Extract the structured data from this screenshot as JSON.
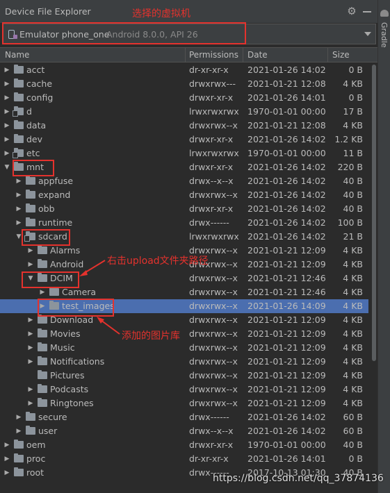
{
  "window": {
    "title": "Device File Explorer",
    "side_tab": "Gradle"
  },
  "device": {
    "name": "Emulator phone_one",
    "detail": "Android 8.0.0, API 26"
  },
  "columns": {
    "name": "Name",
    "permissions": "Permissions",
    "date": "Date",
    "size": "Size"
  },
  "rows": [
    {
      "name": "acct",
      "level": 0,
      "arrow": "right",
      "link": false,
      "perm": "dr-xr-xr-x",
      "date": "2021-01-26 14:02",
      "size": "0 B"
    },
    {
      "name": "cache",
      "level": 0,
      "arrow": "right",
      "link": false,
      "perm": "drwxrwx---",
      "date": "2021-01-21 12:08",
      "size": "4 KB"
    },
    {
      "name": "config",
      "level": 0,
      "arrow": "right",
      "link": false,
      "perm": "drwxr-xr-x",
      "date": "2021-01-26 14:01",
      "size": "0 B"
    },
    {
      "name": "d",
      "level": 0,
      "arrow": "right",
      "link": true,
      "perm": "lrwxrwxrwx",
      "date": "1970-01-01 00:00",
      "size": "17 B"
    },
    {
      "name": "data",
      "level": 0,
      "arrow": "right",
      "link": false,
      "perm": "drwxrwx--x",
      "date": "2021-01-21 12:08",
      "size": "4 KB"
    },
    {
      "name": "dev",
      "level": 0,
      "arrow": "right",
      "link": false,
      "perm": "drwxr-xr-x",
      "date": "2021-01-26 14:02",
      "size": "1.2 KB"
    },
    {
      "name": "etc",
      "level": 0,
      "arrow": "right",
      "link": true,
      "perm": "lrwxrwxrwx",
      "date": "1970-01-01 00:00",
      "size": "11 B"
    },
    {
      "name": "mnt",
      "level": 0,
      "arrow": "down",
      "link": false,
      "perm": "drwxr-xr-x",
      "date": "2021-01-26 14:02",
      "size": "220 B"
    },
    {
      "name": "appfuse",
      "level": 1,
      "arrow": "right",
      "link": false,
      "perm": "drwx--x--x",
      "date": "2021-01-26 14:02",
      "size": "40 B"
    },
    {
      "name": "expand",
      "level": 1,
      "arrow": "right",
      "link": false,
      "perm": "drwxrwx--x",
      "date": "2021-01-26 14:02",
      "size": "40 B"
    },
    {
      "name": "obb",
      "level": 1,
      "arrow": "right",
      "link": false,
      "perm": "drwxr-xr-x",
      "date": "2021-01-26 14:02",
      "size": "40 B"
    },
    {
      "name": "runtime",
      "level": 1,
      "arrow": "right",
      "link": false,
      "perm": "drwx------",
      "date": "2021-01-26 14:02",
      "size": "100 B"
    },
    {
      "name": "sdcard",
      "level": 1,
      "arrow": "down",
      "link": true,
      "perm": "lrwxrwxrwx",
      "date": "2021-01-26 14:02",
      "size": "21 B"
    },
    {
      "name": "Alarms",
      "level": 2,
      "arrow": "right",
      "link": false,
      "perm": "drwxrwx--x",
      "date": "2021-01-21 12:09",
      "size": "4 KB"
    },
    {
      "name": "Android",
      "level": 2,
      "arrow": "right",
      "link": false,
      "perm": "drwxrwx--x",
      "date": "2021-01-21 12:09",
      "size": "4 KB"
    },
    {
      "name": "DCIM",
      "level": 2,
      "arrow": "down",
      "link": false,
      "perm": "drwxrwx--x",
      "date": "2021-01-21 12:46",
      "size": "4 KB"
    },
    {
      "name": "Camera",
      "level": 3,
      "arrow": "right",
      "link": false,
      "perm": "drwxrwx--x",
      "date": "2021-01-21 12:46",
      "size": "4 KB"
    },
    {
      "name": "test_images",
      "level": 3,
      "arrow": "right",
      "link": false,
      "perm": "drwxrwx--x",
      "date": "2021-01-26 14:09",
      "size": "4 KB",
      "selected": true
    },
    {
      "name": "Download",
      "level": 2,
      "arrow": "right",
      "link": false,
      "perm": "drwxrwx--x",
      "date": "2021-01-21 12:09",
      "size": "4 KB"
    },
    {
      "name": "Movies",
      "level": 2,
      "arrow": "right",
      "link": false,
      "perm": "drwxrwx--x",
      "date": "2021-01-21 12:09",
      "size": "4 KB"
    },
    {
      "name": "Music",
      "level": 2,
      "arrow": "right",
      "link": false,
      "perm": "drwxrwx--x",
      "date": "2021-01-21 12:09",
      "size": "4 KB"
    },
    {
      "name": "Notifications",
      "level": 2,
      "arrow": "right",
      "link": false,
      "perm": "drwxrwx--x",
      "date": "2021-01-21 12:09",
      "size": "4 KB"
    },
    {
      "name": "Pictures",
      "level": 2,
      "arrow": "none",
      "link": false,
      "perm": "drwxrwx--x",
      "date": "2021-01-21 12:09",
      "size": "4 KB"
    },
    {
      "name": "Podcasts",
      "level": 2,
      "arrow": "right",
      "link": false,
      "perm": "drwxrwx--x",
      "date": "2021-01-21 12:09",
      "size": "4 KB"
    },
    {
      "name": "Ringtones",
      "level": 2,
      "arrow": "right",
      "link": false,
      "perm": "drwxrwx--x",
      "date": "2021-01-21 12:09",
      "size": "4 KB"
    },
    {
      "name": "secure",
      "level": 1,
      "arrow": "right",
      "link": false,
      "perm": "drwx------",
      "date": "2021-01-26 14:02",
      "size": "60 B"
    },
    {
      "name": "user",
      "level": 1,
      "arrow": "right",
      "link": false,
      "perm": "drwx--x--x",
      "date": "2021-01-26 14:02",
      "size": "60 B"
    },
    {
      "name": "oem",
      "level": 0,
      "arrow": "right",
      "link": false,
      "perm": "drwxr-xr-x",
      "date": "1970-01-01 00:00",
      "size": "40 B"
    },
    {
      "name": "proc",
      "level": 0,
      "arrow": "right",
      "link": false,
      "perm": "dr-xr-xr-x",
      "date": "2021-01-26 14:01",
      "size": "0 B"
    },
    {
      "name": "root",
      "level": 0,
      "arrow": "right",
      "link": false,
      "perm": "drwx------",
      "date": "2017-10-13 01:30",
      "size": "40 B"
    }
  ],
  "annotations": {
    "device_note": "选择的虚拟机",
    "upload_note": "右击upload文件夹路径",
    "added_note": "添加的图片库"
  },
  "watermark": "https://blog.csdn.net/qq_37874136",
  "colors": {
    "background": "#2b2b2b",
    "panel": "#3c3f41",
    "selection": "#4b6eaf",
    "annotation": "#e5322d"
  }
}
